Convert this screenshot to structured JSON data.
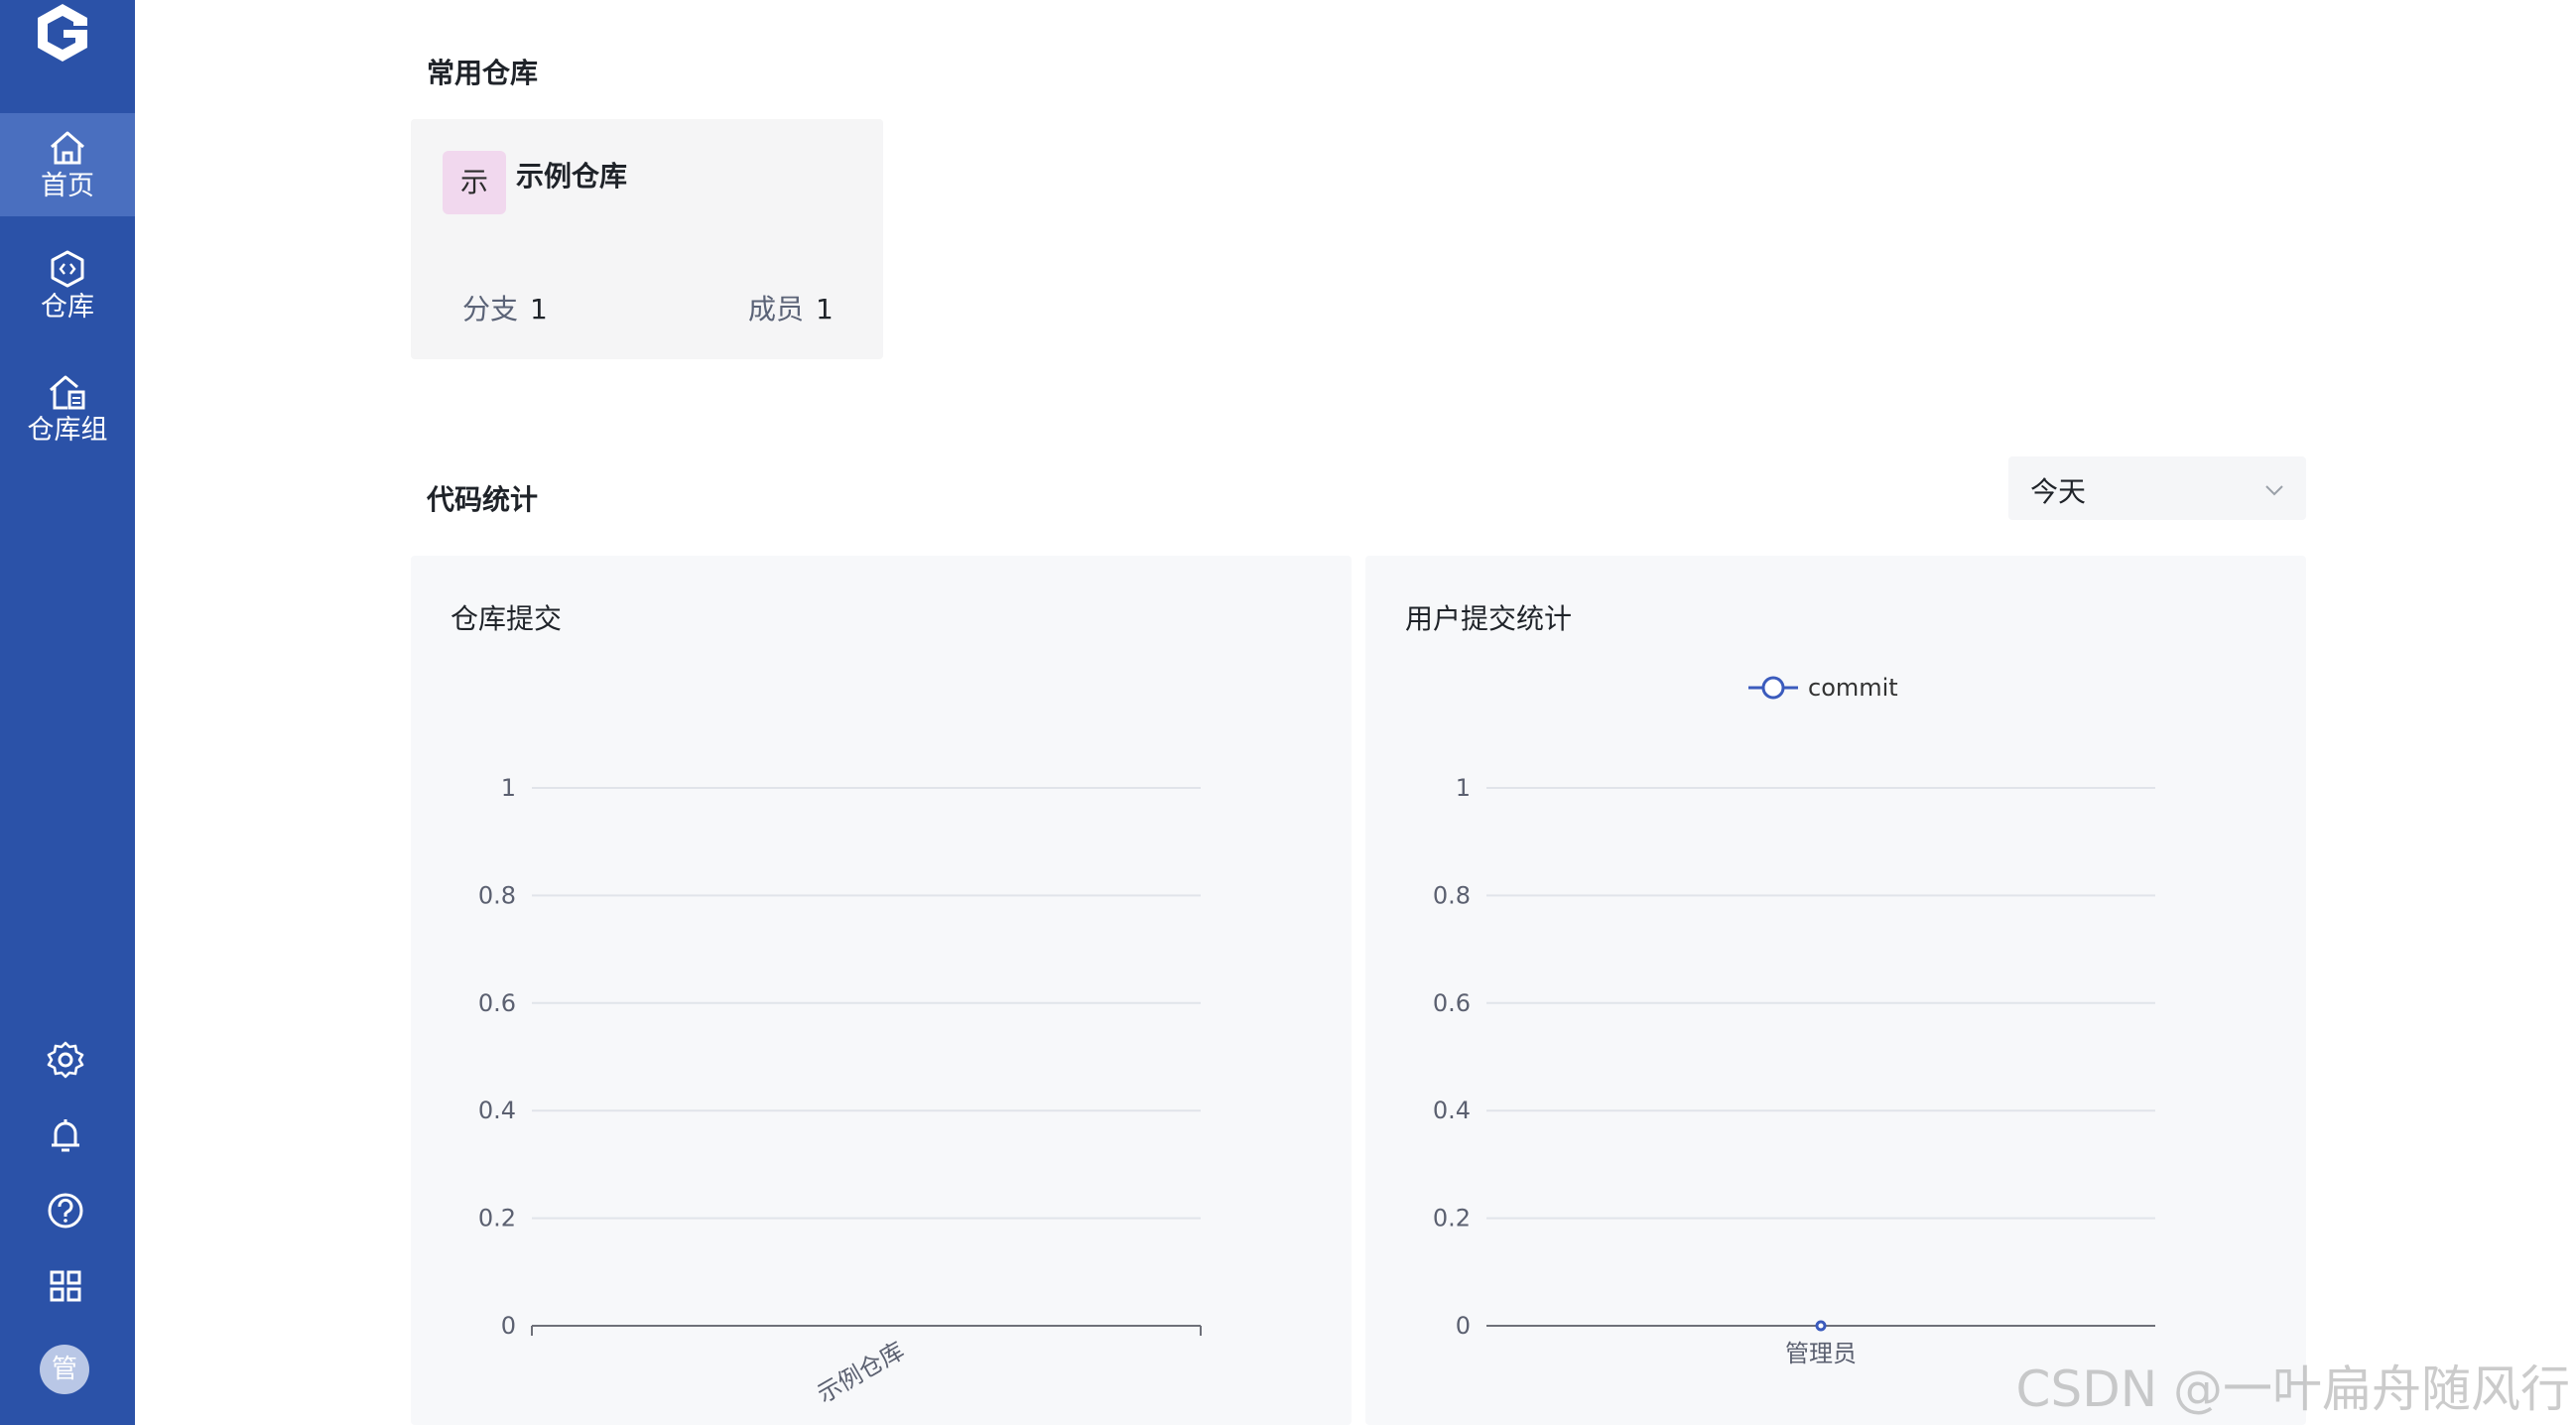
{
  "sidebar": {
    "logo": "gitee-style-logo-icon",
    "items": [
      {
        "label": "首页",
        "icon": "home-icon",
        "active": true
      },
      {
        "label": "仓库",
        "icon": "repo-icon",
        "active": false
      },
      {
        "label": "仓库组",
        "icon": "repo-group-icon",
        "active": false
      }
    ],
    "bottom_icons": [
      "gear-icon",
      "bell-icon",
      "help-icon",
      "apps-grid-icon"
    ],
    "avatar_text": "管"
  },
  "main": {
    "favorites_title": "常用仓库",
    "repo_card": {
      "badge": "示",
      "name": "示例仓库",
      "branch_label": "分支",
      "branch_count": "1",
      "member_label": "成员",
      "member_count": "1"
    },
    "stats_title": "代码统计",
    "period_select": {
      "value": "今天"
    },
    "panels": [
      {
        "title": "仓库提交"
      },
      {
        "title": "用户提交统计",
        "legend": "commit"
      }
    ]
  },
  "chart_data": [
    {
      "type": "bar",
      "title": "仓库提交",
      "categories": [
        "示例仓库"
      ],
      "values": [
        0
      ],
      "ylim": [
        0,
        1
      ],
      "y_ticks": [
        "0",
        "0.2",
        "0.4",
        "0.6",
        "0.8",
        "1"
      ],
      "grid": true
    },
    {
      "type": "line",
      "title": "用户提交统计",
      "categories": [
        "管理员"
      ],
      "series": [
        {
          "name": "commit",
          "values": [
            0
          ]
        }
      ],
      "ylim": [
        0,
        1
      ],
      "y_ticks": [
        "0",
        "0.2",
        "0.4",
        "0.6",
        "0.8",
        "1"
      ],
      "grid": true,
      "legend": "top-center",
      "colors": {
        "series": "#3b5bbd"
      }
    }
  ],
  "watermark": "CSDN @一叶扁舟随风行"
}
